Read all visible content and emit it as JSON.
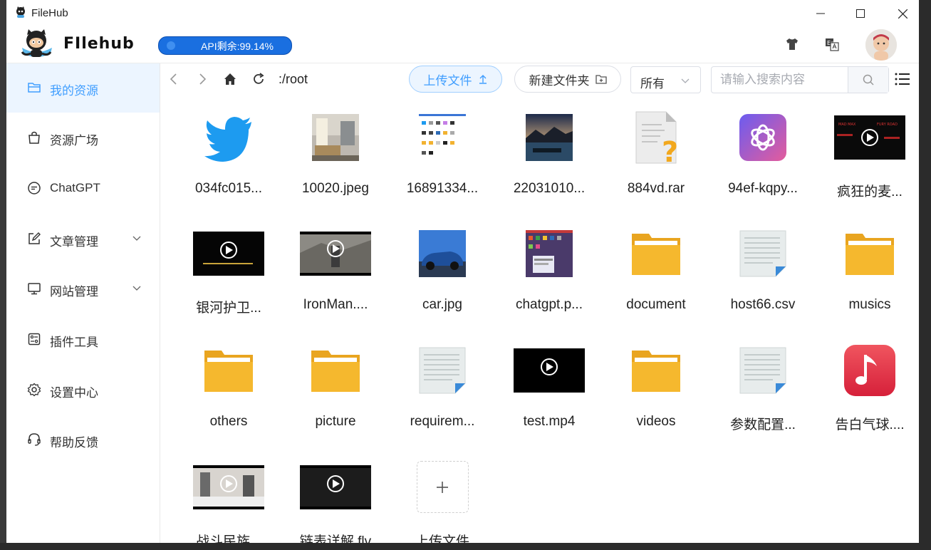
{
  "window": {
    "title": "FileHub"
  },
  "header": {
    "logo_text": "FIlehub",
    "api_label": "API剩余:99.14%",
    "api_progress": 0.9914
  },
  "sidebar": {
    "items": [
      {
        "label": "我的资源",
        "icon": "folder-icon",
        "active": true
      },
      {
        "label": "资源广场",
        "icon": "bag-icon"
      },
      {
        "label": "ChatGPT",
        "icon": "chat-icon"
      },
      {
        "label": "文章管理",
        "icon": "edit-icon",
        "expandable": true
      },
      {
        "label": "网站管理",
        "icon": "monitor-icon",
        "expandable": true
      },
      {
        "label": "插件工具",
        "icon": "plugin-icon"
      },
      {
        "label": "设置中心",
        "icon": "gear-icon"
      },
      {
        "label": "帮助反馈",
        "icon": "headset-icon"
      }
    ]
  },
  "toolbar": {
    "path": ":/root",
    "upload_label": "上传文件",
    "new_folder_label": "新建文件夹",
    "filter_value": "所有",
    "search_placeholder": "请输入搜索内容"
  },
  "files": [
    {
      "name": "034fc015...",
      "type": "twitter-image"
    },
    {
      "name": "10020.jpeg",
      "type": "room-photo"
    },
    {
      "name": "16891334...",
      "type": "screenshot-image"
    },
    {
      "name": "22031010...",
      "type": "lake-photo"
    },
    {
      "name": "884vd.rar",
      "type": "unknown-file"
    },
    {
      "name": "94ef-kqpy...",
      "type": "openai-image"
    },
    {
      "name": "疯狂的麦...",
      "type": "video"
    },
    {
      "name": "银河护卫...",
      "type": "video"
    },
    {
      "name": "IronMan....",
      "type": "video"
    },
    {
      "name": "car.jpg",
      "type": "car-photo"
    },
    {
      "name": "chatgpt.p...",
      "type": "screenshot-image-2"
    },
    {
      "name": "document",
      "type": "folder"
    },
    {
      "name": "host66.csv",
      "type": "text-file"
    },
    {
      "name": "musics",
      "type": "folder"
    },
    {
      "name": "others",
      "type": "folder"
    },
    {
      "name": "picture",
      "type": "folder"
    },
    {
      "name": "requirem...",
      "type": "text-file"
    },
    {
      "name": "test.mp4",
      "type": "video"
    },
    {
      "name": "videos",
      "type": "folder"
    },
    {
      "name": "参数配置...",
      "type": "text-file"
    },
    {
      "name": "告白气球....",
      "type": "music-file"
    },
    {
      "name": "战斗民族...",
      "type": "video"
    },
    {
      "name": "链表详解.flv",
      "type": "video"
    },
    {
      "name": "上传文件",
      "type": "upload-tile"
    }
  ],
  "colors": {
    "accent": "#409eff",
    "api_pill": "#1a6fe0",
    "folder": "#f5b82e"
  }
}
